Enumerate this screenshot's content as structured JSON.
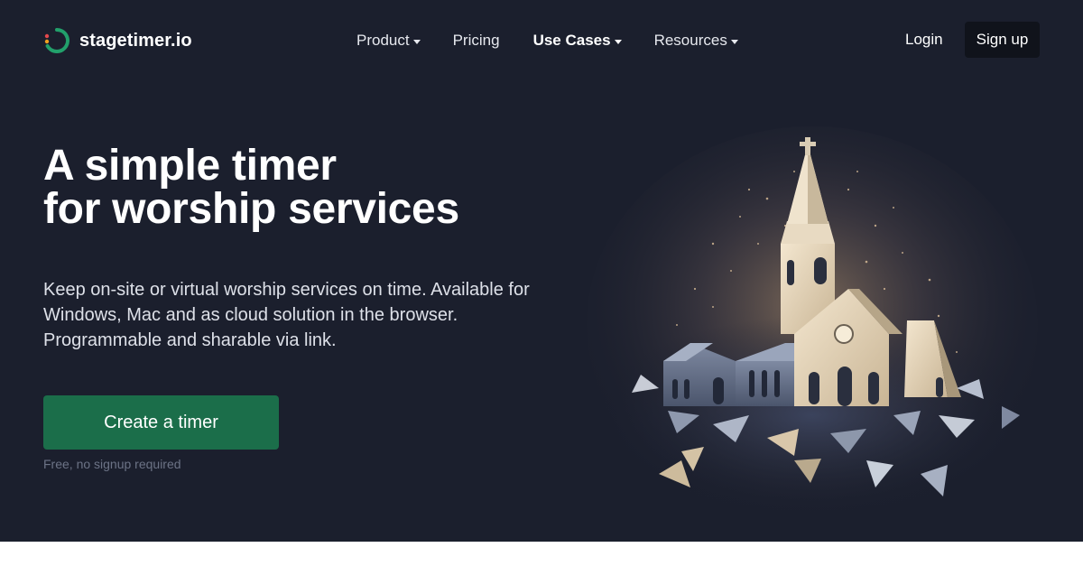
{
  "brand": {
    "name": "stagetimer.io",
    "colors": {
      "ring": "#22a06b",
      "dot_red": "#e5484d",
      "dot_orange": "#f0a020"
    }
  },
  "nav": {
    "items": [
      {
        "label": "Product",
        "has_dropdown": true,
        "icon": "chevron-down-icon"
      },
      {
        "label": "Pricing",
        "has_dropdown": false
      },
      {
        "label": "Use Cases",
        "has_dropdown": true,
        "icon": "chevron-down-icon",
        "active": true
      },
      {
        "label": "Resources",
        "has_dropdown": true,
        "icon": "chevron-down-icon"
      }
    ],
    "login_label": "Login",
    "signup_label": "Sign up"
  },
  "hero": {
    "headline_line1": "A simple timer",
    "headline_line2": "for worship services",
    "description": "Keep on-site or virtual worship services on time. Available for Windows, Mac and as cloud solution in the browser. Programmable and sharable via link.",
    "cta_label": "Create a timer",
    "cta_note": "Free, no signup required",
    "illustration": "church-illustration",
    "colors": {
      "background": "#1b1f2d",
      "cta": "#1b6e4a"
    }
  }
}
